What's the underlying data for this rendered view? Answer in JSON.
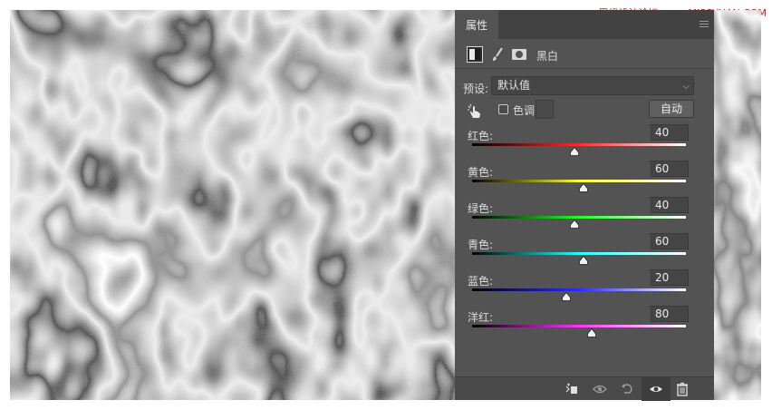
{
  "watermark": "思缘设计论坛 www.MISSYUAN.COM",
  "panel": {
    "tab_label": "属性",
    "adjustment_title": "黑白",
    "preset_label": "预设:",
    "preset_value": "默认值",
    "tint_label": "色调",
    "auto_button": "自动"
  },
  "sliders": [
    {
      "label": "红色:",
      "value": "40",
      "fraction": 0.48,
      "color": "#ff2a2a"
    },
    {
      "label": "黄色:",
      "value": "60",
      "fraction": 0.52,
      "color": "#ffff33"
    },
    {
      "label": "绿色:",
      "value": "40",
      "fraction": 0.48,
      "color": "#22ff22"
    },
    {
      "label": "青色:",
      "value": "60",
      "fraction": 0.52,
      "color": "#22ffff"
    },
    {
      "label": "蓝色:",
      "value": "20",
      "fraction": 0.44,
      "color": "#2a2aff"
    },
    {
      "label": "洋红:",
      "value": "80",
      "fraction": 0.56,
      "color": "#ff33ff"
    }
  ],
  "bottom_icons": [
    "clip-to-layer-icon",
    "view-previous-state-icon",
    "reset-icon",
    "visibility-eye-icon",
    "trash-icon"
  ]
}
